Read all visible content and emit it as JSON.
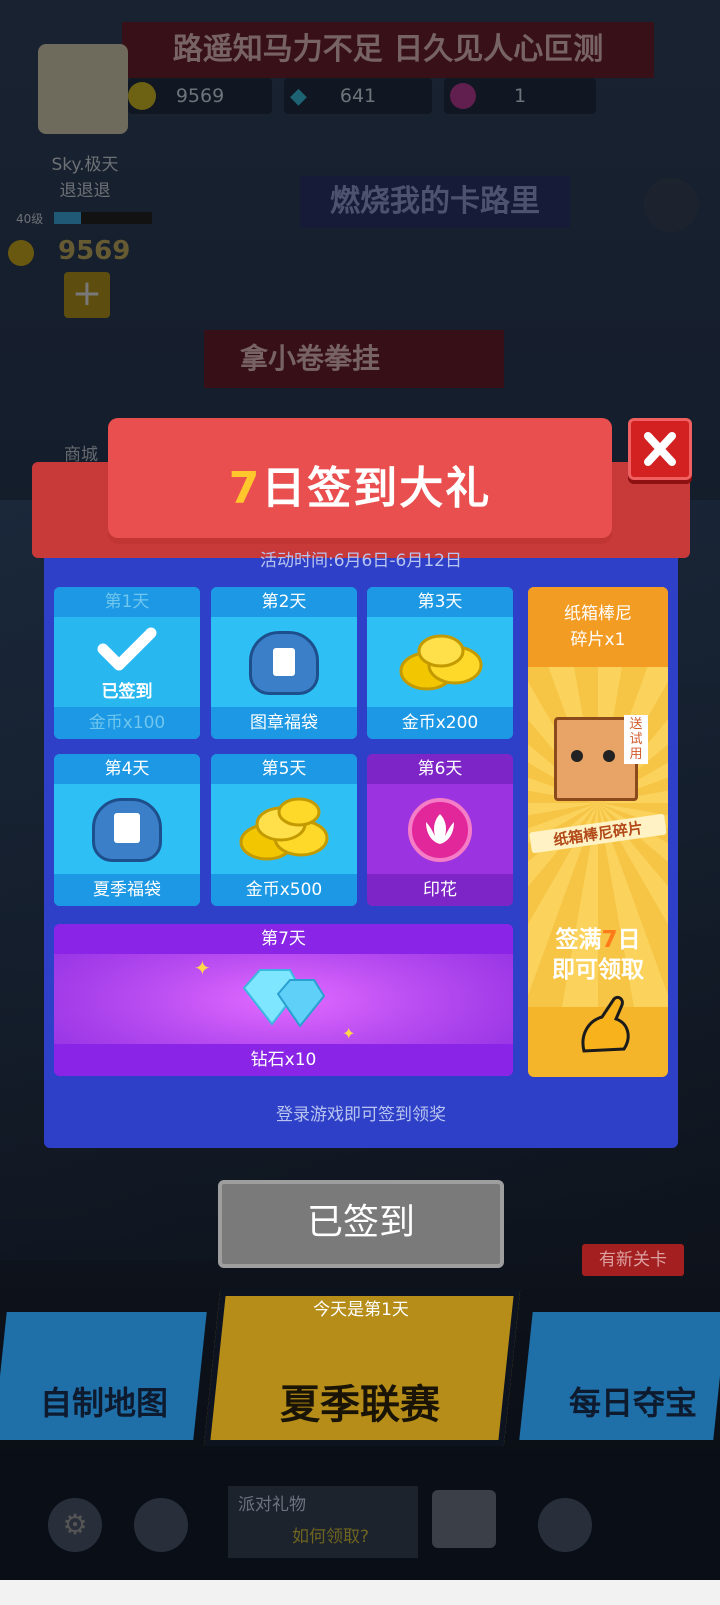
{
  "background": {
    "top_banner": "路遥知马力不足 日久见人心叵测",
    "mid_banner": "燃烧我的卡路里",
    "low_banner": "拿小卷拳挂",
    "player": {
      "name": "Sky.极天",
      "subtitle": "退退退",
      "level": "40级",
      "coins": "9569"
    },
    "resources": {
      "gold": "9569",
      "diamond": "641",
      "flower": "1"
    },
    "shop_label": "商城",
    "bottom_tiles": {
      "left": "自制地图",
      "center": "夏季联赛",
      "right": "每日夺宝",
      "new_level_badge": "有新关卡"
    },
    "party_gift": {
      "title": "派对礼物",
      "link": "如何领取?"
    }
  },
  "dialog": {
    "title_num": "7",
    "title_rest": "日签到大礼",
    "period": "活动时间:6月6日-6月12日",
    "days": [
      {
        "day": "第1天",
        "reward": "金币x100",
        "status": "已签到"
      },
      {
        "day": "第2天",
        "reward": "图章福袋"
      },
      {
        "day": "第3天",
        "reward": "金币x200"
      },
      {
        "day": "第4天",
        "reward": "夏季福袋"
      },
      {
        "day": "第5天",
        "reward": "金币x500"
      },
      {
        "day": "第6天",
        "reward": "印花"
      },
      {
        "day": "第7天",
        "reward": "钻石x10"
      }
    ],
    "bonus": {
      "title_line1": "纸箱棒尼",
      "title_line2": "碎片x1",
      "tag": "送试用",
      "item_label": "纸箱棒尼碎片",
      "condition_a": "签满",
      "condition_num": "7",
      "condition_b": "日",
      "condition_line2": "即可领取"
    },
    "hint": "登录游戏即可签到领奖",
    "button_label": "已签到",
    "today_text": "今天是第1天"
  }
}
